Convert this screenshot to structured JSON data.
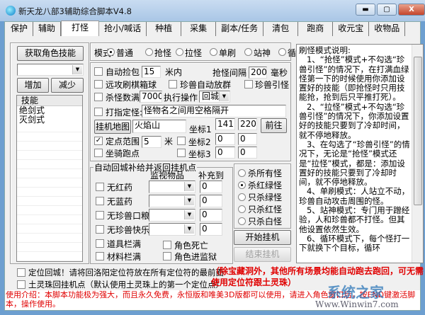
{
  "window": {
    "title": "新天龙八部3辅助综合脚本V4.8",
    "minimize": "▬",
    "maximize": "▢",
    "close": "X"
  },
  "tabs": [
    "保护",
    "辅助",
    "打怪",
    "抢小/喊话",
    "种植",
    "采集",
    "副本/任务",
    "清包",
    "跑商",
    "收元宝",
    "收物品"
  ],
  "left": {
    "get_skills": "获取角色技能",
    "add": "增加",
    "remove": "减少",
    "list_header": "技能",
    "skills": [
      "绝剑式",
      "灭剑式"
    ]
  },
  "mode": {
    "label": "模式:",
    "options": [
      "普通",
      "抢怪",
      "拉怪",
      "单刷",
      "站神",
      "循环"
    ],
    "selected": 0
  },
  "settings": {
    "auto_pick": "自动捡包",
    "auto_pick_value": "15",
    "auto_pick_unit": "米内",
    "grab_interval": "抢怪间隔",
    "grab_interval_value": "200",
    "grab_interval_unit": "毫秒",
    "ranged_chess": "远攻刷棋箱球",
    "pet_auto_group": "珍兽自动放群",
    "pet_lure": "珍兽引怪",
    "kill_full": "杀怪数满",
    "kill_full_value": "7000",
    "exec_action": "执行操作",
    "action_value": "回城",
    "target_monster": "打指定怪:",
    "target_monster_value": "怪物名之间用空格隔开",
    "map_button": "挂机地图",
    "map_value": "火焰山",
    "coord1": "坐标1",
    "coord1_x": "141",
    "coord1_y": "220",
    "go_button": "前往",
    "fixed_range": "定点范围",
    "fixed_range_value": "5",
    "fixed_range_unit": "米",
    "coord2": "坐标2",
    "coord2_x": "0",
    "coord2_y": "0",
    "mount_run": "坐骑跑点",
    "coord3": "坐标3",
    "coord3_x": "0",
    "coord3_y": "0"
  },
  "supply": {
    "legend": "自动回城补给并返回挂机点",
    "col_item": "监视物品",
    "col_refill": "补充到",
    "rows": [
      {
        "label": "无红药",
        "value": "0"
      },
      {
        "label": "无蓝药",
        "value": "0"
      },
      {
        "label": "无珍兽口粮",
        "value": "0"
      },
      {
        "label": "无珍兽快乐",
        "value": "0"
      }
    ],
    "bag_full": "道具栏满",
    "char_dead": "角色死亡",
    "mat_full": "材料栏满",
    "char_jail": "角色进监狱"
  },
  "target": {
    "options": [
      "杀所有怪",
      "杀红绿怪",
      "只杀绿怪",
      "只杀红怪",
      "只杀白怪"
    ],
    "selected": 1
  },
  "start": "开始挂机",
  "stop": "结束挂机",
  "help": {
    "text": "刷怪模式说明:\n   1、“抢怪”模式+不勾选“珍兽引怪”的情况下，在打满血绿怪第一下的时候使用你添加设置好的技能（即抢怪时只用技能抢，抢到后只平推打死）。\n   2、“拉怪”模式+不勾选“珍兽引怪”的情况下，你添加设置好的技能只要到了冷却时间，就不停地释放。\n   3、在勾选了“珍兽引怪”的情况下，无论是“抢怪”模式还是“拉怪”模式，都是：添加设置好的技能只要到了冷却时间，就不停地释放。\n   4、单刷模式：人站立不动，珍兽自动攻击周围的怪。\n   5、站神模式：专门用于蹭经验，人和珍兽都不打怪。但其他设置依然生效。\n   6、循环模式下，每个怪打一下就换下个目标，循环"
  },
  "bottom": {
    "locate_return": "定位回城！请将回洛阳定位符放在所有定位符的最前面",
    "earth_bead": "土灵珠回挂机点（默认使用土灵珠上的第一个定位点）",
    "note": "（除宝藏洞外，其他所有场景均能自动跑去跑回，可无需使用定位符跟土灵珠）",
    "intro": "使用介绍：本脚本功能极为强大，而且永久免费，永恒版和唯美3D版都可以使用，请进入角色窗口后，按END键激活脚本，操作使用。"
  },
  "watermark": {
    "brand": "系统之家",
    "url": "Www.Winwin7.com"
  }
}
